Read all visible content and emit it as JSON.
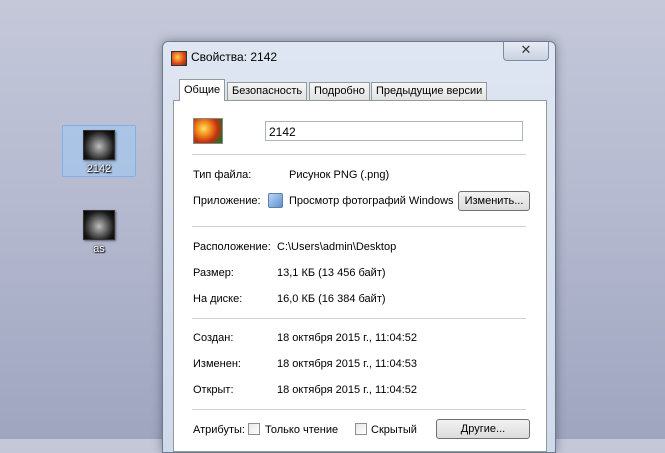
{
  "desktop": {
    "icons": [
      {
        "label": "2142"
      },
      {
        "label": "as"
      }
    ]
  },
  "window": {
    "title": "Свойства: 2142",
    "close_glyph": "✕"
  },
  "tabs": [
    {
      "label": "Общие"
    },
    {
      "label": "Безопасность"
    },
    {
      "label": "Подробно"
    },
    {
      "label": "Предыдущие версии"
    }
  ],
  "general": {
    "file_name": "2142",
    "file_type_label": "Тип файла:",
    "file_type_value": "Рисунок PNG (.png)",
    "app_label": "Приложение:",
    "app_value": "Просмотр фотографий Windows",
    "change_button": "Изменить...",
    "location_label": "Расположение:",
    "location_value": "C:\\Users\\admin\\Desktop",
    "size_label": "Размер:",
    "size_value": "13,1 КБ (13 456 байт)",
    "disk_label": "На диске:",
    "disk_value": "16,0 КБ (16 384 байт)",
    "created_label": "Создан:",
    "created_value": "18 октября 2015 г., 11:04:52",
    "modified_label": "Изменен:",
    "modified_value": "18 октября 2015 г., 11:04:53",
    "opened_label": "Открыт:",
    "opened_value": "18 октября 2015 г., 11:04:52",
    "attributes_label": "Атрибуты:",
    "readonly_label": "Только чтение",
    "hidden_label": "Скрытый",
    "other_button": "Другие..."
  }
}
